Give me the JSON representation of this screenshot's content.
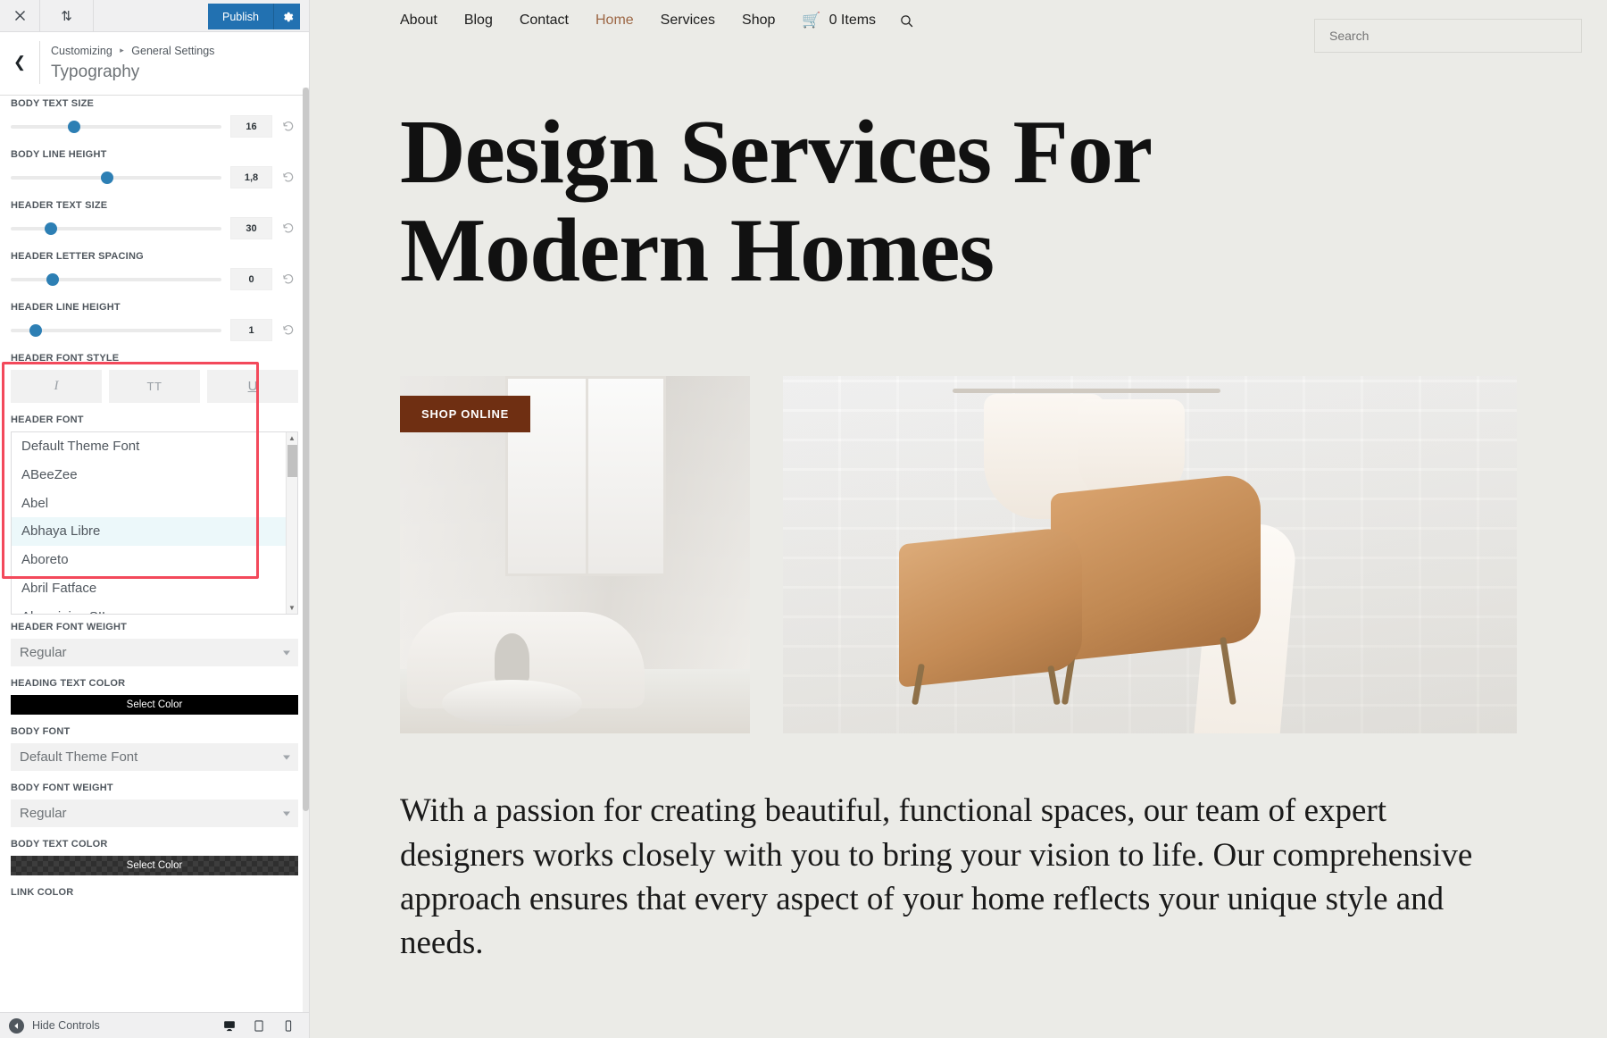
{
  "customizer": {
    "topbar": {
      "close_icon": "close-icon",
      "devices_toggle_icon": "updown-arrows-icon",
      "publish_label": "Publish",
      "gear_icon": "gear-icon"
    },
    "header": {
      "back_icon": "chevron-left-icon",
      "breadcrumb_root": "Customizing",
      "breadcrumb_sep": "▸",
      "breadcrumb_section": "General Settings",
      "panel_title": "Typography"
    },
    "sliders": [
      {
        "label": "BODY TEXT SIZE",
        "value": "16",
        "percent": 27
      },
      {
        "label": "BODY LINE HEIGHT",
        "value": "1,8",
        "percent": 43
      },
      {
        "label": "HEADER TEXT SIZE",
        "value": "30",
        "percent": 16
      },
      {
        "label": "HEADER LETTER SPACING",
        "value": "0",
        "percent": 17
      },
      {
        "label": "HEADER LINE HEIGHT",
        "value": "1",
        "percent": 10
      }
    ],
    "reset_icon": "reset-arrow-icon",
    "font_style": {
      "label": "HEADER FONT STYLE",
      "buttons": [
        {
          "name": "italic",
          "glyph": "I"
        },
        {
          "name": "uppercase",
          "glyph": "TT"
        },
        {
          "name": "underline",
          "glyph": "U"
        }
      ]
    },
    "header_font": {
      "label": "HEADER FONT",
      "selected": "Abhaya Libre",
      "options": [
        "Default Theme Font",
        "ABeeZee",
        "Abel",
        "Abhaya Libre",
        "Aboreto",
        "Abril Fatface",
        "Abyssinica SIL"
      ]
    },
    "header_font_weight": {
      "label": "HEADER FONT WEIGHT",
      "value": "Regular"
    },
    "heading_text_color": {
      "label": "HEADING TEXT COLOR",
      "button": "Select Color",
      "color": "#000000"
    },
    "body_font": {
      "label": "BODY FONT",
      "value": "Default Theme Font"
    },
    "body_font_weight": {
      "label": "BODY FONT WEIGHT",
      "value": "Regular"
    },
    "body_text_color": {
      "label": "BODY TEXT COLOR",
      "button": "Select Color",
      "color": "transparent"
    },
    "link_color": {
      "label": "LINK COLOR"
    },
    "footer": {
      "hide_controls_label": "Hide Controls",
      "hide_icon": "chevron-left-circle-icon",
      "devices": [
        {
          "name": "desktop-preview",
          "icon": "desktop-icon"
        },
        {
          "name": "tablet-preview",
          "icon": "tablet-icon"
        },
        {
          "name": "mobile-preview",
          "icon": "mobile-icon"
        }
      ]
    }
  },
  "preview": {
    "nav": {
      "items": [
        "About",
        "Blog",
        "Contact",
        "Home",
        "Services",
        "Shop"
      ],
      "active": "Home",
      "cart_icon": "shopping-cart-icon",
      "cart_label": "0 Items",
      "search_icon": "search-icon",
      "accent_color": "#9c6644"
    },
    "search": {
      "placeholder": "Search",
      "value": ""
    },
    "hero_title": "Design Services For Modern Homes",
    "shop_badge": "SHOP ONLINE",
    "paragraph": "With a passion for creating beautiful, functional spaces, our team of expert designers works closely with you to bring your vision to life. Our comprehensive approach ensures that every aspect of your home reflects your unique style and needs."
  }
}
